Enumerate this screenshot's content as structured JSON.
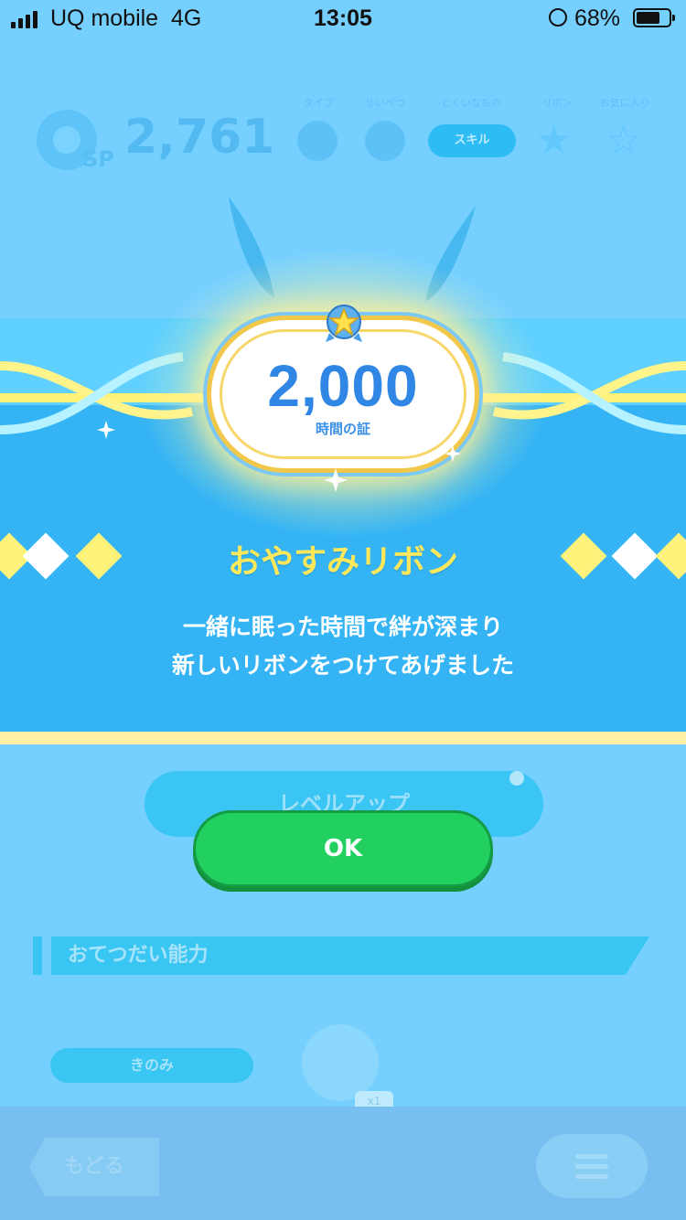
{
  "status_bar": {
    "carrier": "UQ mobile",
    "network": "4G",
    "time": "13:05",
    "battery": "68%"
  },
  "header": {
    "sp_label": "SP",
    "points": "2,761",
    "labels": [
      "タイプ",
      "せいべつ",
      "とくいなもの",
      "リボン",
      "お気に入り"
    ],
    "skill": "スキル"
  },
  "ribbon": {
    "hours": "2,000",
    "caption": "時間の証",
    "title": "おやすみリボン",
    "line1": "一緒に眠った時間で絆が深まり",
    "line2": "新しいリボンをつけてあげました"
  },
  "buttons": {
    "level_up": "レベルアップ",
    "ok": "OK",
    "back": "もどる"
  },
  "section": {
    "title": "おてつだい能力",
    "ingredient": "きのみ",
    "qty": "x1"
  },
  "colors": {
    "banner": "#34b4f5",
    "ok": "#22d060",
    "title": "#ffe95a",
    "badge_text": "#2f86e4"
  }
}
